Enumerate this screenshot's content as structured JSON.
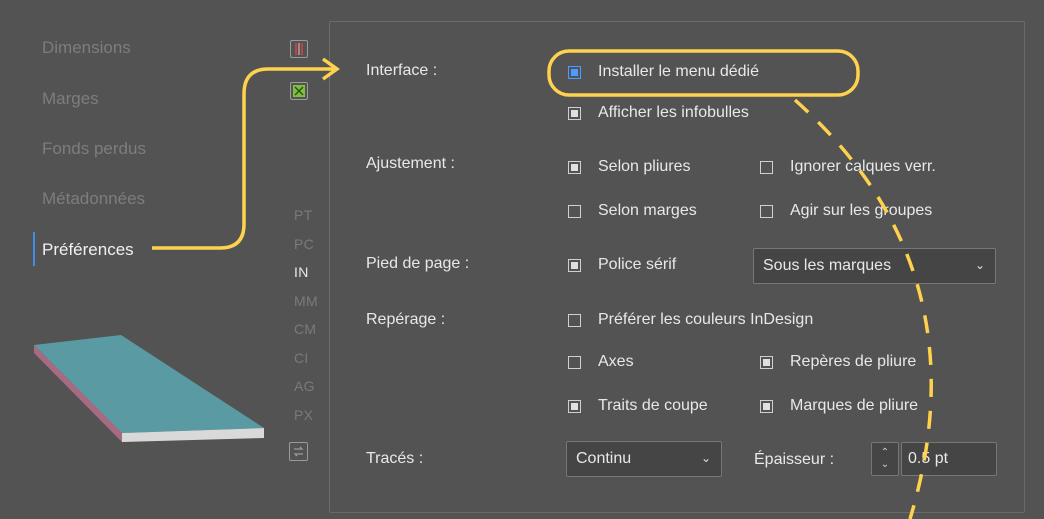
{
  "sidebar": {
    "items": [
      {
        "label": "Dimensions",
        "active": false
      },
      {
        "label": "Marges",
        "active": false
      },
      {
        "label": "Fonds perdus",
        "active": false
      },
      {
        "label": "Métadonnées",
        "active": false
      },
      {
        "label": "Préférences",
        "active": true
      }
    ]
  },
  "units": [
    "PT",
    "PC",
    "IN",
    "MM",
    "CM",
    "CI",
    "AG",
    "PX"
  ],
  "active_unit": "IN",
  "form": {
    "interface_label": "Interface :",
    "install_menu": "Installer le menu dédié",
    "show_tooltips": "Afficher les infobulles",
    "adjust_label": "Ajustement :",
    "by_folds": "Selon pliures",
    "ignore_locked_layers": "Ignorer calques verr.",
    "by_margins": "Selon marges",
    "act_on_groups": "Agir sur les groupes",
    "footer_label": "Pied de page :",
    "serif_font": "Police sérif",
    "footer_position": "Sous les marques",
    "marks_label": "Repérage :",
    "prefer_indesign_colors": "Préférer les couleurs InDesign",
    "axes": "Axes",
    "fold_guides": "Repères de pliure",
    "crop_marks": "Traits de coupe",
    "fold_marks": "Marques de pliure",
    "strokes_label": "Tracés :",
    "stroke_style": "Continu",
    "thickness_label": "Épaisseur :",
    "thickness_value": "0.5 pt"
  },
  "colors": {
    "background": "#535353",
    "accent": "#3d8ee8",
    "annotation": "#ffd24d"
  },
  "icons": [
    "guides-icon",
    "print-icon",
    "swap-icon",
    "chevron-down-icon"
  ]
}
